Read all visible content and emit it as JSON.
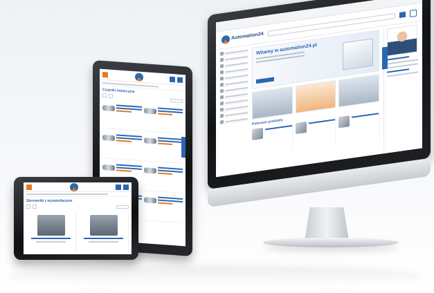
{
  "scene": {
    "background_color": "#f2f4f7"
  },
  "brand": {
    "logo_text": "Automation24",
    "primary_color": "#2a67b1",
    "accent_color": "#e87722"
  },
  "monitor": {
    "hero_title": "Witamy w automation24.pl",
    "section_title": "Polecane produkty",
    "icons": [
      "search-icon",
      "cart-icon",
      "user-icon"
    ]
  },
  "tablet": {
    "title": "Czujniki indukcyjne",
    "icons": [
      "menu-icon",
      "search-icon",
      "cart-icon"
    ]
  },
  "phone": {
    "title": "Sterowniki z wyświetlaczem",
    "icons": [
      "menu-icon",
      "search-icon",
      "cart-icon"
    ]
  }
}
